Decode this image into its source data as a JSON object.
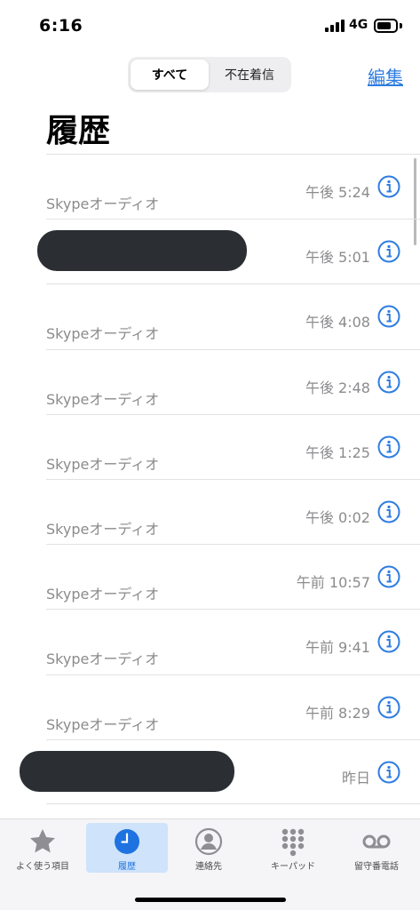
{
  "status_bar": {
    "time": "6:16",
    "network": "4G"
  },
  "segmented": {
    "all": "すべて",
    "missed": "不在着信"
  },
  "edit": "編集",
  "title": "履歴",
  "calls": [
    {
      "sub": "Skypeオーディオ",
      "time": "午後 5:24"
    },
    {
      "sub": "",
      "time": "午後 5:01"
    },
    {
      "sub": "Skypeオーディオ",
      "time": "午後 4:08"
    },
    {
      "sub": "Skypeオーディオ",
      "time": "午後 2:48"
    },
    {
      "sub": "Skypeオーディオ",
      "time": "午後 1:25"
    },
    {
      "sub": "Skypeオーディオ",
      "time": "午後 0:02"
    },
    {
      "sub": "Skypeオーディオ",
      "time": "午前 10:57"
    },
    {
      "sub": "Skypeオーディオ",
      "time": "午前 9:41"
    },
    {
      "sub": "Skypeオーディオ",
      "time": "午前 8:29"
    },
    {
      "sub": "",
      "time": "昨日"
    }
  ],
  "tabs": [
    {
      "label": "よく使う項目",
      "icon": "star-icon"
    },
    {
      "label": "履歴",
      "icon": "clock-icon"
    },
    {
      "label": "連絡先",
      "icon": "contact-icon"
    },
    {
      "label": "キーパッド",
      "icon": "keypad-icon"
    },
    {
      "label": "留守番電話",
      "icon": "voicemail-icon"
    }
  ],
  "colors": {
    "accent": "#2f7de1",
    "secondary_text": "#8b8b8e",
    "redaction": "#2b2f33"
  }
}
